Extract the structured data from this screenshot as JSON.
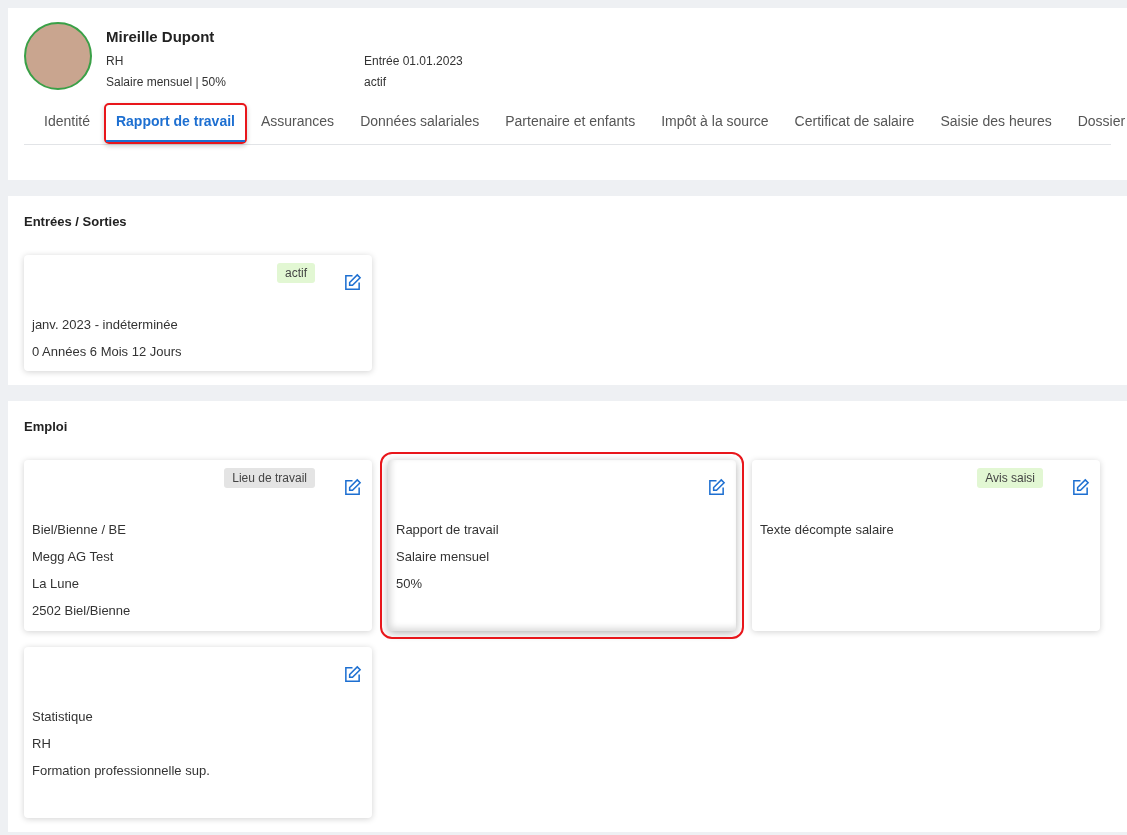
{
  "profile": {
    "name": "Mireille Dupont",
    "lines_left": [
      "RH",
      "Salaire mensuel | 50%"
    ],
    "lines_right": [
      "Entrée 01.01.2023",
      "actif"
    ]
  },
  "tabs": [
    {
      "label": "Identité",
      "selected": false,
      "highlighted": false
    },
    {
      "label": "Rapport de travail",
      "selected": true,
      "highlighted": true
    },
    {
      "label": "Assurances",
      "selected": false,
      "highlighted": false
    },
    {
      "label": "Données salariales",
      "selected": false,
      "highlighted": false
    },
    {
      "label": "Partenaire et enfants",
      "selected": false,
      "highlighted": false
    },
    {
      "label": "Impôt à la source",
      "selected": false,
      "highlighted": false
    },
    {
      "label": "Certificat de salaire",
      "selected": false,
      "highlighted": false
    },
    {
      "label": "Saisie des heures",
      "selected": false,
      "highlighted": false
    },
    {
      "label": "Dossier",
      "selected": false,
      "highlighted": false
    }
  ],
  "sections": [
    {
      "title": "Entrées / Sorties",
      "cards": [
        {
          "tag": {
            "label": "actif",
            "color": "#e2f7d3"
          },
          "highlighted": false,
          "lines": [
            "janv. 2023 - indéterminée",
            "0 Années 6 Mois 12 Jours"
          ]
        }
      ]
    },
    {
      "title": "Emploi",
      "cards": [
        {
          "tag": {
            "label": "Lieu de travail",
            "color": "#e4e4e4"
          },
          "highlighted": false,
          "lines": [
            "Biel/Bienne / BE",
            "Megg AG Test",
            "La Lune",
            "2502 Biel/Bienne"
          ]
        },
        {
          "highlighted": true,
          "lines": [
            "Rapport de travail",
            "Salaire mensuel",
            "50%"
          ]
        },
        {
          "tag": {
            "label": "Avis saisi",
            "color": "#e2f7d3"
          },
          "highlighted": false,
          "lines": [
            "Texte décompte salaire"
          ]
        },
        {
          "highlighted": false,
          "lines": [
            "Statistique",
            "RH",
            "Formation professionnelle sup."
          ]
        }
      ]
    }
  ]
}
